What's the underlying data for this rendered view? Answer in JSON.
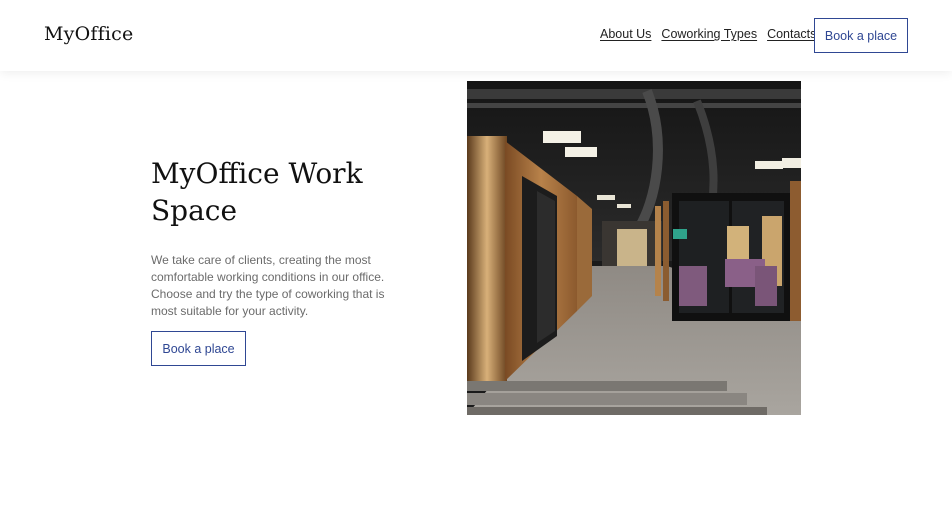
{
  "header": {
    "logo": "MyOffice",
    "nav": [
      {
        "label": "About Us"
      },
      {
        "label": "Coworking Types"
      },
      {
        "label": "Contacts"
      }
    ],
    "cta": "Book a place"
  },
  "hero": {
    "title": "MyOffice Work Space",
    "description": "We take care of clients, creating the most comfortable working conditions in our office. Choose and try the type of coworking that is most suitable for your activity.",
    "cta": "Book a place"
  },
  "colors": {
    "accent": "#2f4793",
    "text_muted": "#6b6b6b",
    "background": "#ffffff"
  }
}
